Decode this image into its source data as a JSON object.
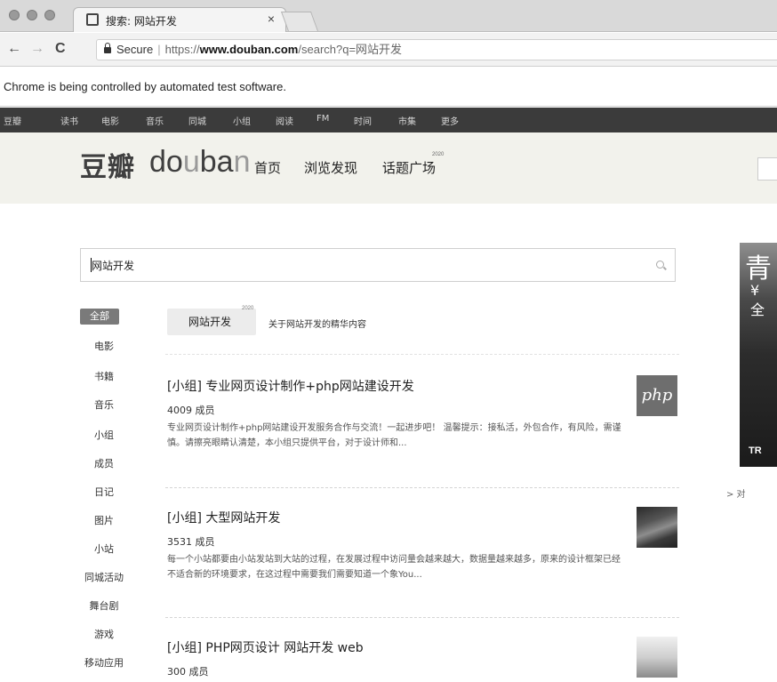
{
  "browser": {
    "tab_title": "搜索: 网站开发",
    "tab_close": "×",
    "back": "←",
    "forward": "→",
    "reload": "C",
    "secure_label": "Secure",
    "url_prefix": "https://",
    "url_host": "www.douban.com",
    "url_rest": "/search?q=网站开发",
    "automation_notice": "Chrome is being controlled by automated test software."
  },
  "global_nav": [
    "豆瓣",
    "读书",
    "电影",
    "音乐",
    "同城",
    "小组",
    "阅读",
    "FM",
    "时间",
    "市集",
    "更多"
  ],
  "header": {
    "logo_cn": "豆瓣",
    "logo_en_dark1": "do",
    "logo_en_light": "u",
    "logo_en_dark2": "ba",
    "logo_en_light2": "n",
    "nav": [
      "首页",
      "浏览发现",
      "话题广场"
    ],
    "nav_badge": "2020"
  },
  "search": {
    "query": "网站开发"
  },
  "categories": [
    "全部",
    "电影",
    "书籍",
    "音乐",
    "小组",
    "成员",
    "日记",
    "图片",
    "小站",
    "同城活动",
    "舞台剧",
    "游戏",
    "移动应用"
  ],
  "topic": {
    "label": "网站开发",
    "badge": "2020",
    "description": "关于网站开发的精华内容"
  },
  "results": [
    {
      "title": "[小组]  专业网页设计制作+php网站建设开发",
      "members": "4009 成员",
      "description": "专业网页设计制作+php网站建设开发服务合作与交流！一起进步吧！ 温馨提示：接私活，外包合作，有风险，需谨慎。请擦亮眼睛认清楚，本小组只提供平台，对于设计师和...",
      "thumb_label": "php"
    },
    {
      "title": "[小组]  大型网站开发",
      "members": "3531 成员",
      "description": "每一个小站都要由小站发站到大站的过程，在发展过程中访问量会越来越大，数据量越来越多，原来的设计框架已经不适合新的环境要求，在这过程中需要我们需要知道一个象You..."
    },
    {
      "title": "[小组]  PHP网页设计 网站开发 web",
      "members": "300 成员"
    }
  ],
  "ad": {
    "char1": "青",
    "char2": "¥",
    "char3": "全",
    "char4": "TR",
    "link": "> 对"
  }
}
